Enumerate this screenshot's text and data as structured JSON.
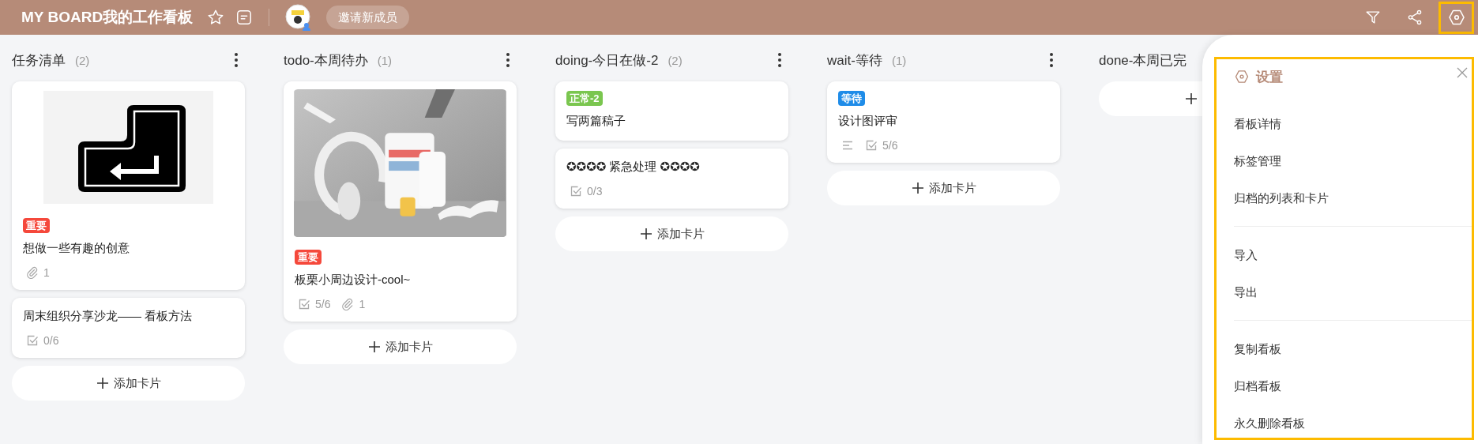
{
  "header": {
    "title": "MY BOARD我的工作看板",
    "invite_button": "邀请新成员",
    "settings_highlighted": true
  },
  "lists": [
    {
      "title": "任务清单",
      "count": "(2)",
      "add_button": "添加卡片",
      "cards": [
        {
          "cover": {
            "kind": "return-key"
          },
          "labels": [
            {
              "text": "重要",
              "color": "#f5483b"
            }
          ],
          "title": "想做一些有趣的创意",
          "meta": [
            {
              "kind": "attachment",
              "text": "1"
            }
          ]
        },
        {
          "title": "周末组织分享沙龙—— 看板方法",
          "meta": [
            {
              "kind": "checklist",
              "text": "0/6"
            }
          ]
        }
      ]
    },
    {
      "title": "todo-本周待办",
      "count": "(1)",
      "add_button": "添加卡片",
      "cards": [
        {
          "cover": {
            "kind": "picture"
          },
          "labels": [
            {
              "text": "重要",
              "color": "#f5483b"
            }
          ],
          "title": "板栗小周边设计-cool~",
          "meta": [
            {
              "kind": "checklist",
              "text": "5/6"
            },
            {
              "kind": "attachment",
              "text": "1"
            }
          ]
        }
      ]
    },
    {
      "title": "doing-今日在做-2",
      "count": "(2)",
      "add_button": "添加卡片",
      "cards": [
        {
          "labels": [
            {
              "text": "正常-2",
              "color": "#7ac64f"
            }
          ],
          "title": "写两篇稿子"
        },
        {
          "title": "✪✪✪✪ 紧急处理 ✪✪✪✪",
          "meta": [
            {
              "kind": "checklist",
              "text": "0/3"
            }
          ]
        }
      ]
    },
    {
      "title": "wait-等待",
      "count": "(1)",
      "add_button": "添加卡片",
      "cards": [
        {
          "labels": [
            {
              "text": "等待",
              "color": "#1f8ce8"
            }
          ],
          "title": "设计图评审",
          "meta": [
            {
              "kind": "description"
            },
            {
              "kind": "checklist",
              "text": "5/6"
            }
          ]
        }
      ]
    },
    {
      "title": "done-本周已完"
    }
  ],
  "settings": {
    "title": "设置",
    "highlighted": true,
    "groups": [
      [
        "看板详情",
        "标签管理",
        "归档的列表和卡片"
      ],
      [
        "导入",
        "导出"
      ],
      [
        "复制看板",
        "归档看板",
        "永久删除看板"
      ]
    ]
  }
}
